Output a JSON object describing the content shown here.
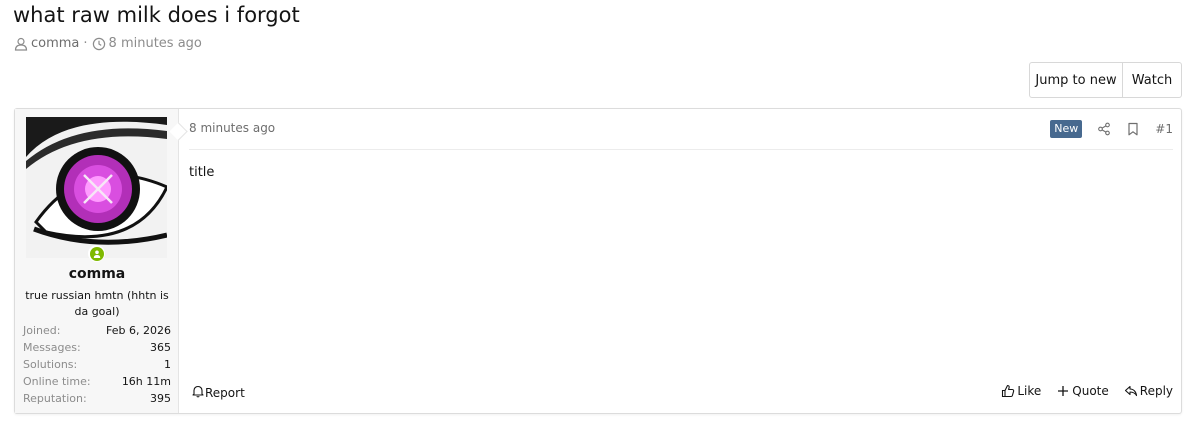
{
  "thread": {
    "title": "what raw milk does i forgot",
    "author": "comma",
    "separator": "·",
    "time": "8 minutes ago"
  },
  "buttons": {
    "jump_to_new": "Jump to new",
    "watch": "Watch"
  },
  "post": {
    "user": {
      "name": "comma",
      "title": "true russian hmtn (hhtn is da goal)",
      "status": "online",
      "extras": [
        {
          "label": "Joined:",
          "value": "Feb 6, 2026"
        },
        {
          "label": "Messages:",
          "value": "365"
        },
        {
          "label": "Solutions:",
          "value": "1"
        },
        {
          "label": "Online time:",
          "value": "16h 11m"
        },
        {
          "label": "Reputation:",
          "value": "395"
        }
      ]
    },
    "date": "8 minutes ago",
    "new_badge": "New",
    "number": "#1",
    "body": "title",
    "actions": {
      "report": "Report",
      "like": "Like",
      "quote": "Quote",
      "reply": "Reply"
    }
  },
  "colors": {
    "new_badge": "#47698f",
    "online": "#7fb900",
    "user_cell_bg": "#f7f7f7"
  },
  "icons": {
    "author": "user-icon",
    "time": "clock-icon",
    "share": "share-icon",
    "bookmark": "bookmark-icon",
    "report": "bell-icon",
    "like": "thumbs-up-icon",
    "quote": "plus-icon",
    "reply": "reply-icon"
  }
}
